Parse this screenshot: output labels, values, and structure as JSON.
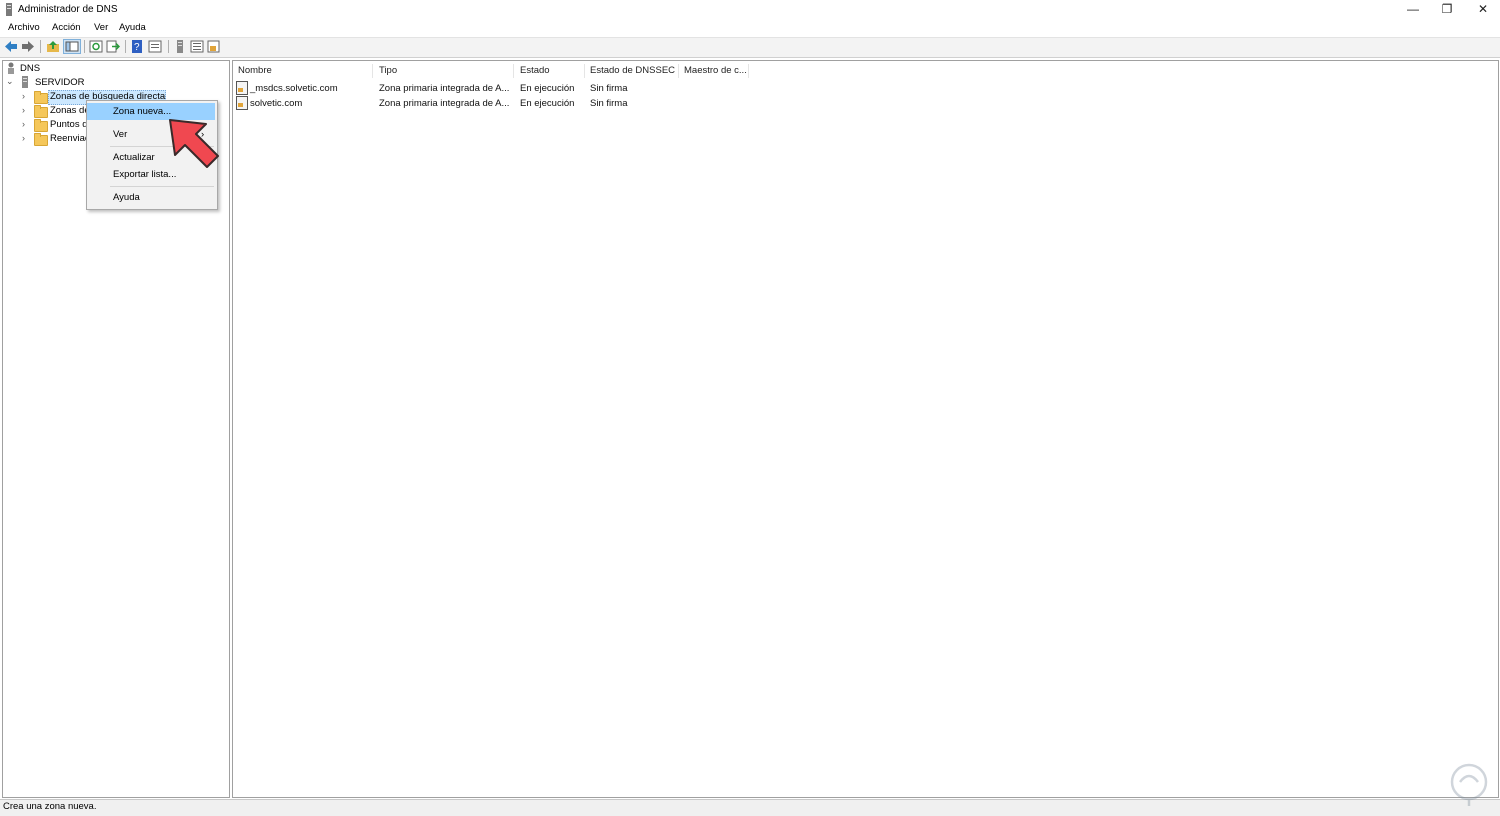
{
  "window": {
    "title": "Administrador de DNS",
    "controls": {
      "minimize": "—",
      "restore": "❐",
      "close": "✕"
    }
  },
  "menu": [
    "Archivo",
    "Acción",
    "Ver",
    "Ayuda"
  ],
  "tree": {
    "root": "DNS",
    "server": "SERVIDOR",
    "children": [
      "Zonas de búsqueda directa",
      "Zonas de",
      "Puntos d",
      "Reenviac"
    ]
  },
  "table": {
    "columns": [
      "Nombre",
      "Tipo",
      "Estado",
      "Estado de DNSSEC",
      "Maestro de c..."
    ],
    "rows": [
      [
        "_msdcs.solvetic.com",
        "Zona primaria integrada de A...",
        "En ejecución",
        "Sin firma",
        ""
      ],
      [
        "solvetic.com",
        "Zona primaria integrada de A...",
        "En ejecución",
        "Sin firma",
        ""
      ]
    ]
  },
  "context_menu": {
    "items": [
      "Zona nueva...",
      "Ver",
      "Actualizar",
      "Exportar lista...",
      "Ayuda"
    ],
    "submenu_arrow": "›"
  },
  "status": "Crea una zona nueva.",
  "colors": {
    "selection": "#99d1ff",
    "highlight": "#cce8ff",
    "arrow": "#f04850"
  }
}
